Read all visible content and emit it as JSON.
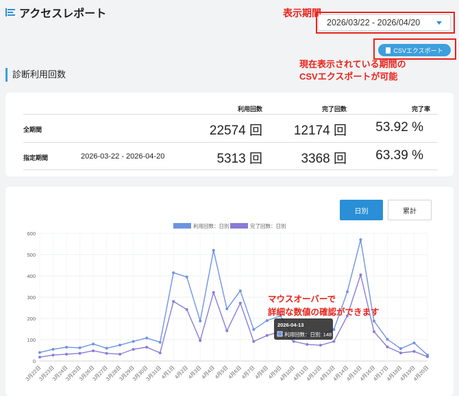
{
  "header": {
    "title": "アクセスレポート"
  },
  "annotations": {
    "period_label": "表示期間",
    "csv_note_line1": "現在表示されている期間の",
    "csv_note_line2": "CSVエクスポートが可能",
    "hover_note_line1": "マウスオーバーで",
    "hover_note_line2": "詳細な数値の確認ができます"
  },
  "period_select": {
    "value": "2026/03/22 - 2026/04/20"
  },
  "csv_button": {
    "label": "CSVエクスポート"
  },
  "section": {
    "title": "診断利用回数"
  },
  "stats": {
    "headers": {
      "uses": "利用回数",
      "completed": "完了回数",
      "rate": "完了率"
    },
    "rows": [
      {
        "label": "全期間",
        "range": "",
        "uses": "22574 回",
        "completed": "12174 回",
        "rate": "53.92 %"
      },
      {
        "label": "指定期間",
        "range": "2026-03-22 - 2026-04-20",
        "uses": "5313 回",
        "completed": "3368 回",
        "rate": "63.39 %"
      }
    ]
  },
  "tabs": {
    "daily": "日別",
    "cumulative": "累計"
  },
  "tooltip": {
    "title": "2026-04-13",
    "text": "利用回数：日別: 148"
  },
  "colors": {
    "uses": "#6d93e0",
    "completed": "#8a7bd6",
    "accent": "#2a8fd6",
    "annotation": "#e8231a"
  },
  "chart_data": {
    "type": "line",
    "x": [
      "3月22日",
      "3月23日",
      "3月24日",
      "3月25日",
      "3月26日",
      "3月27日",
      "3月28日",
      "3月29日",
      "3月30日",
      "3月31日",
      "4月1日",
      "4月2日",
      "4月3日",
      "4月4日",
      "4月5日",
      "4月6日",
      "4月7日",
      "4月8日",
      "4月9日",
      "4月10日",
      "4月11日",
      "4月12日",
      "4月13日",
      "4月14日",
      "4月15日",
      "4月16日",
      "4月17日",
      "4月18日",
      "4月19日",
      "4月20日"
    ],
    "series": [
      {
        "name": "利用回数：日別",
        "values": [
          40,
          55,
          65,
          62,
          80,
          60,
          75,
          92,
          108,
          88,
          415,
          395,
          188,
          520,
          245,
          330,
          148,
          190,
          212,
          112,
          118,
          122,
          148,
          325,
          570,
          188,
          102,
          58,
          85,
          28
        ]
      },
      {
        "name": "完了回数：日別",
        "values": [
          18,
          28,
          32,
          36,
          48,
          36,
          32,
          55,
          65,
          38,
          280,
          242,
          96,
          322,
          142,
          272,
          92,
          120,
          138,
          92,
          78,
          74,
          92,
          212,
          405,
          138,
          66,
          38,
          45,
          20
        ]
      }
    ],
    "ylim": [
      0,
      600
    ],
    "yticks": [
      0,
      100,
      200,
      300,
      400,
      500,
      600
    ],
    "grid": true,
    "legend": "top"
  }
}
